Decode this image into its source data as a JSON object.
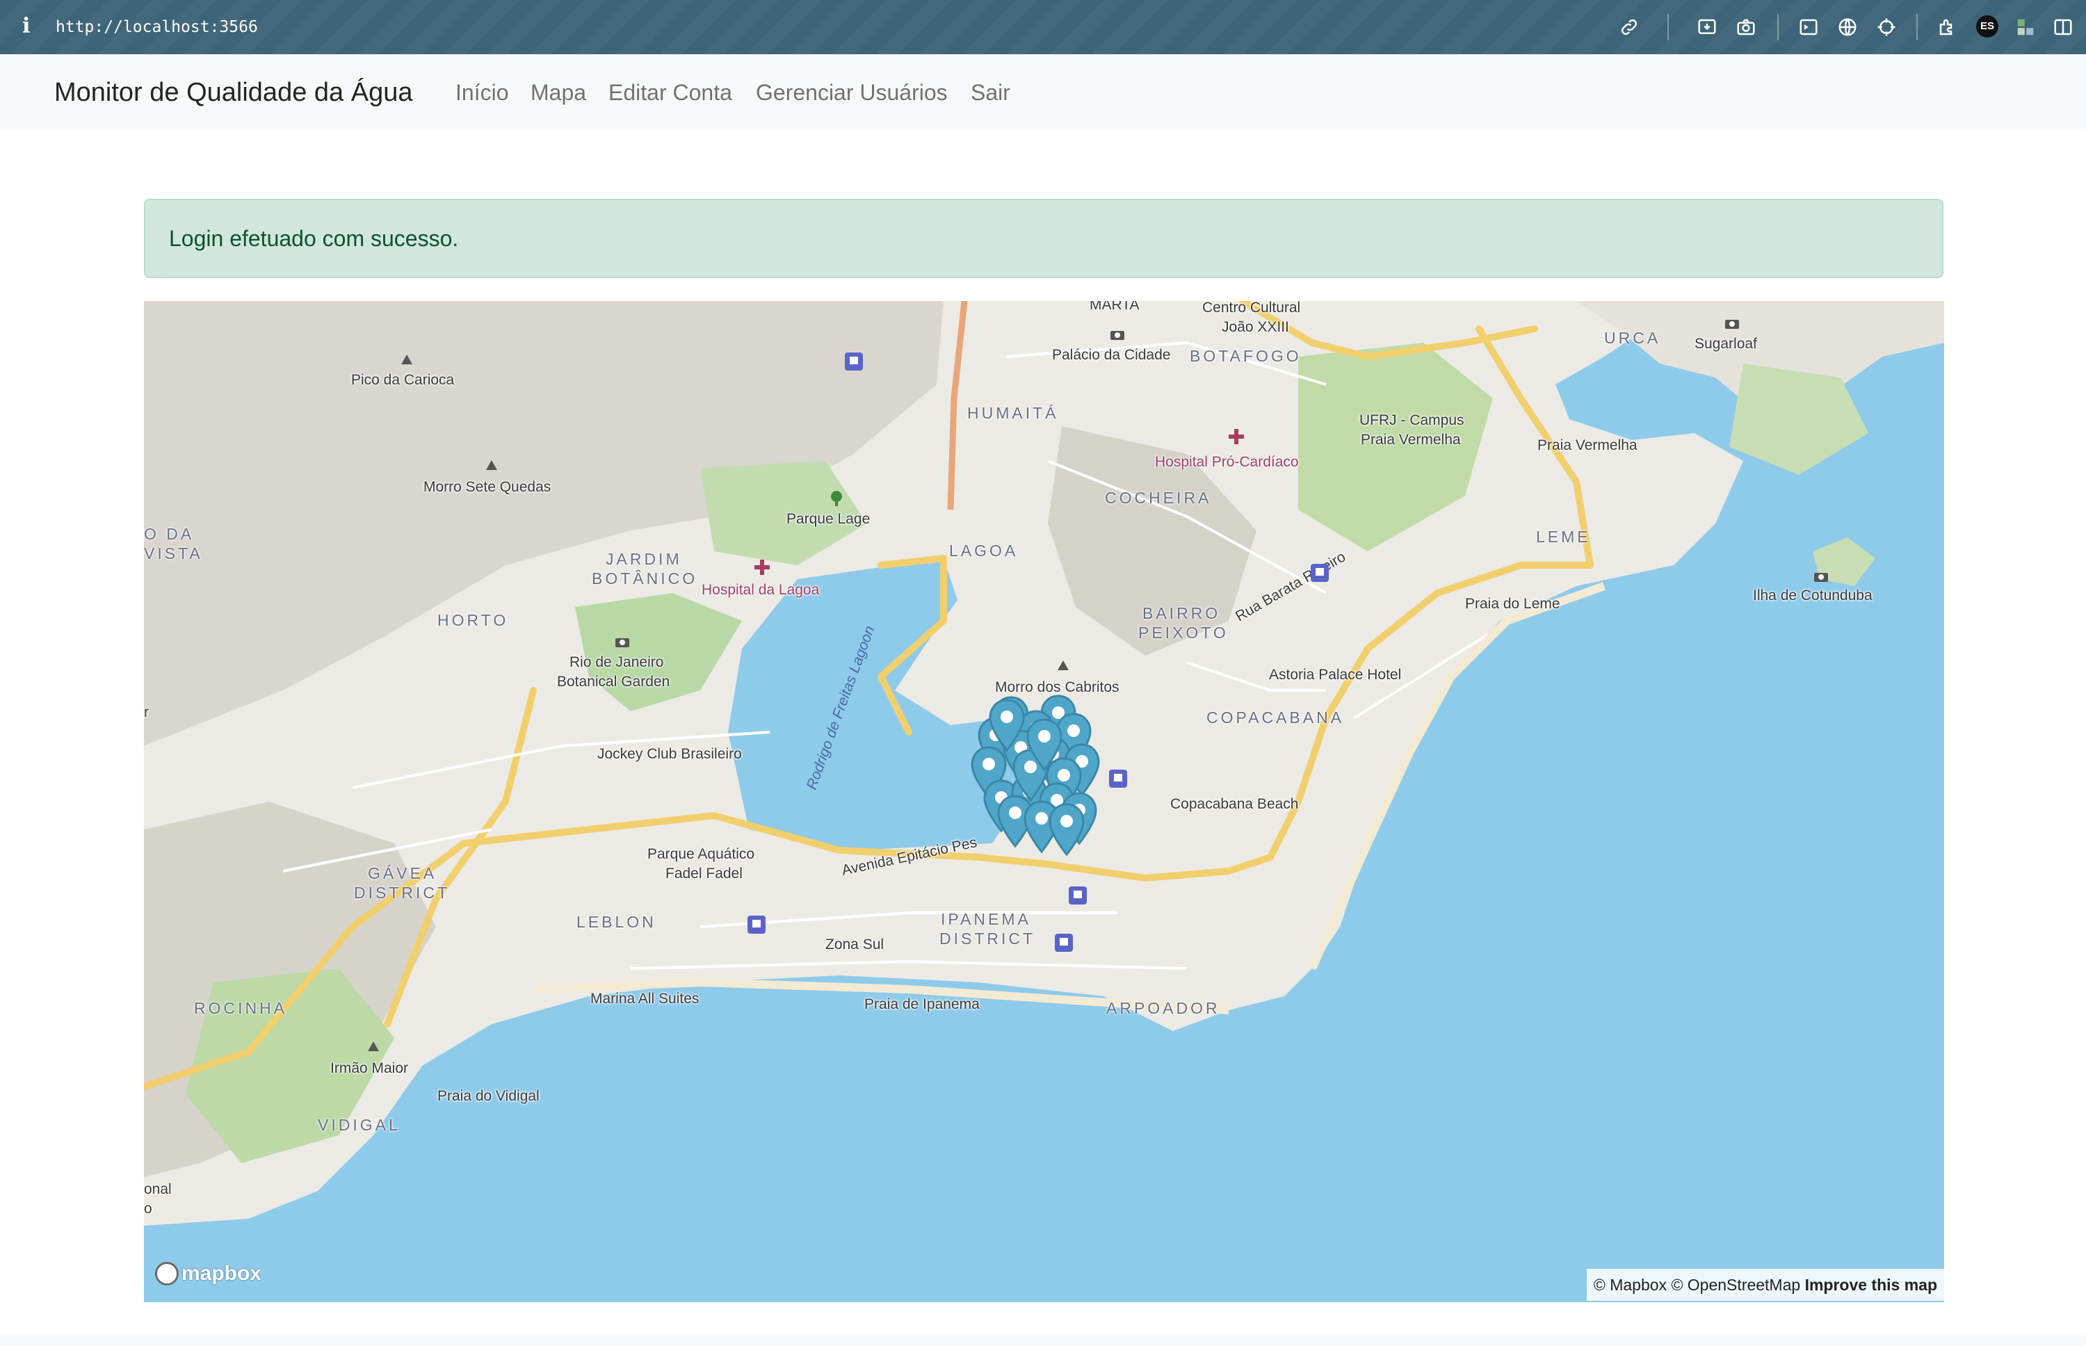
{
  "browser": {
    "info_icon": "i",
    "url": "http://localhost:3566",
    "profile_badge": "ES",
    "icons": [
      "link-icon",
      "screenshot-icon",
      "camera-icon",
      "terminal-icon",
      "globe-icon",
      "crosshair-icon",
      "extensions-icon",
      "avatar",
      "puzzle-icon",
      "sidebar-icon"
    ]
  },
  "navbar": {
    "brand": "Monitor de Qualidade da Água",
    "links": [
      "Início",
      "Mapa",
      "Editar Conta",
      "Gerenciar Usuários",
      "Sair"
    ]
  },
  "alert": {
    "message": "Login efetuado com sucesso.",
    "color": "#d1e7dd"
  },
  "map": {
    "provider_logo": "mapbox",
    "attribution": {
      "mapbox": "© Mapbox",
      "osm": "© OpenStreetMap",
      "improve": "Improve this map"
    },
    "places": {
      "marta": "MARTA",
      "centro_cultural": "Centro Cultural",
      "joao_xxiii": "João XXIII",
      "palacio": "Palácio da Cidade",
      "botafogo": "BOTAFOGO",
      "urca": "URCA",
      "sugarloaf": "Sugarloaf",
      "pico": "Pico da Carioca",
      "humaita": "HUMAITÁ",
      "ufrj1": "UFRJ - Campus",
      "ufrj2": "Praia Vermelha",
      "praia_vermelha": "Praia Vermelha",
      "hospital_pro": "Hospital Pró-Cardíaco",
      "morro_sete": "Morro Sete Quedas",
      "parque_lage": "Parque Lage",
      "cocheira": "COCHEIRA",
      "leme": "LEME",
      "lagoa": "LAGOA",
      "oda": "O DA",
      "vista": "VISTA",
      "jardim": "JARDIM",
      "botanico": "BOTÂNICO",
      "hospital_lagoa": "Hospital da Lagoa",
      "ilha": "Ilha de Cotunduba",
      "horto": "HORTO",
      "bairro": "BAIRRO",
      "peixoto": "PEIXOTO",
      "praia_leme": "Praia do Leme",
      "rua_barata": "Rua Barata Ribeiro",
      "rio_botanical1": "Rio de Janeiro",
      "rio_botanical2": "Botanical Garden",
      "morro_cabritos": "Morro dos Cabritos",
      "astoria": "Astoria Palace Hotel",
      "rodrigo": "Rodrigo de Freitas Lagoon",
      "copacabana": "COPACABANA",
      "jockey": "Jockey Club Brasileiro",
      "copa_beach": "Copacabana Beach",
      "parque_aquatico1": "Parque Aquático",
      "parque_aquatico2": "Fadel Fadel",
      "avenida": "Avenida Epitácio Pes",
      "gavea": "GÁVEA",
      "district": "DISTRICT",
      "leblon": "LEBLON",
      "ipanema": "IPANEMA",
      "ipanema_district": "DISTRICT",
      "zona_sul": "Zona Sul",
      "marina": "Marina All Suites",
      "praia_ipanema": "Praia de Ipanema",
      "arpoador": "ARPOADOR",
      "rocinha": "ROCINHA",
      "irmao": "Irmão Maior",
      "vidigal_praia": "Praia do Vidigal",
      "vidigal": "VIDIGAL",
      "onal": "onal",
      "o": "o",
      "r": "r"
    },
    "marker_color": "#4fa6c8",
    "marker_count": 20
  }
}
